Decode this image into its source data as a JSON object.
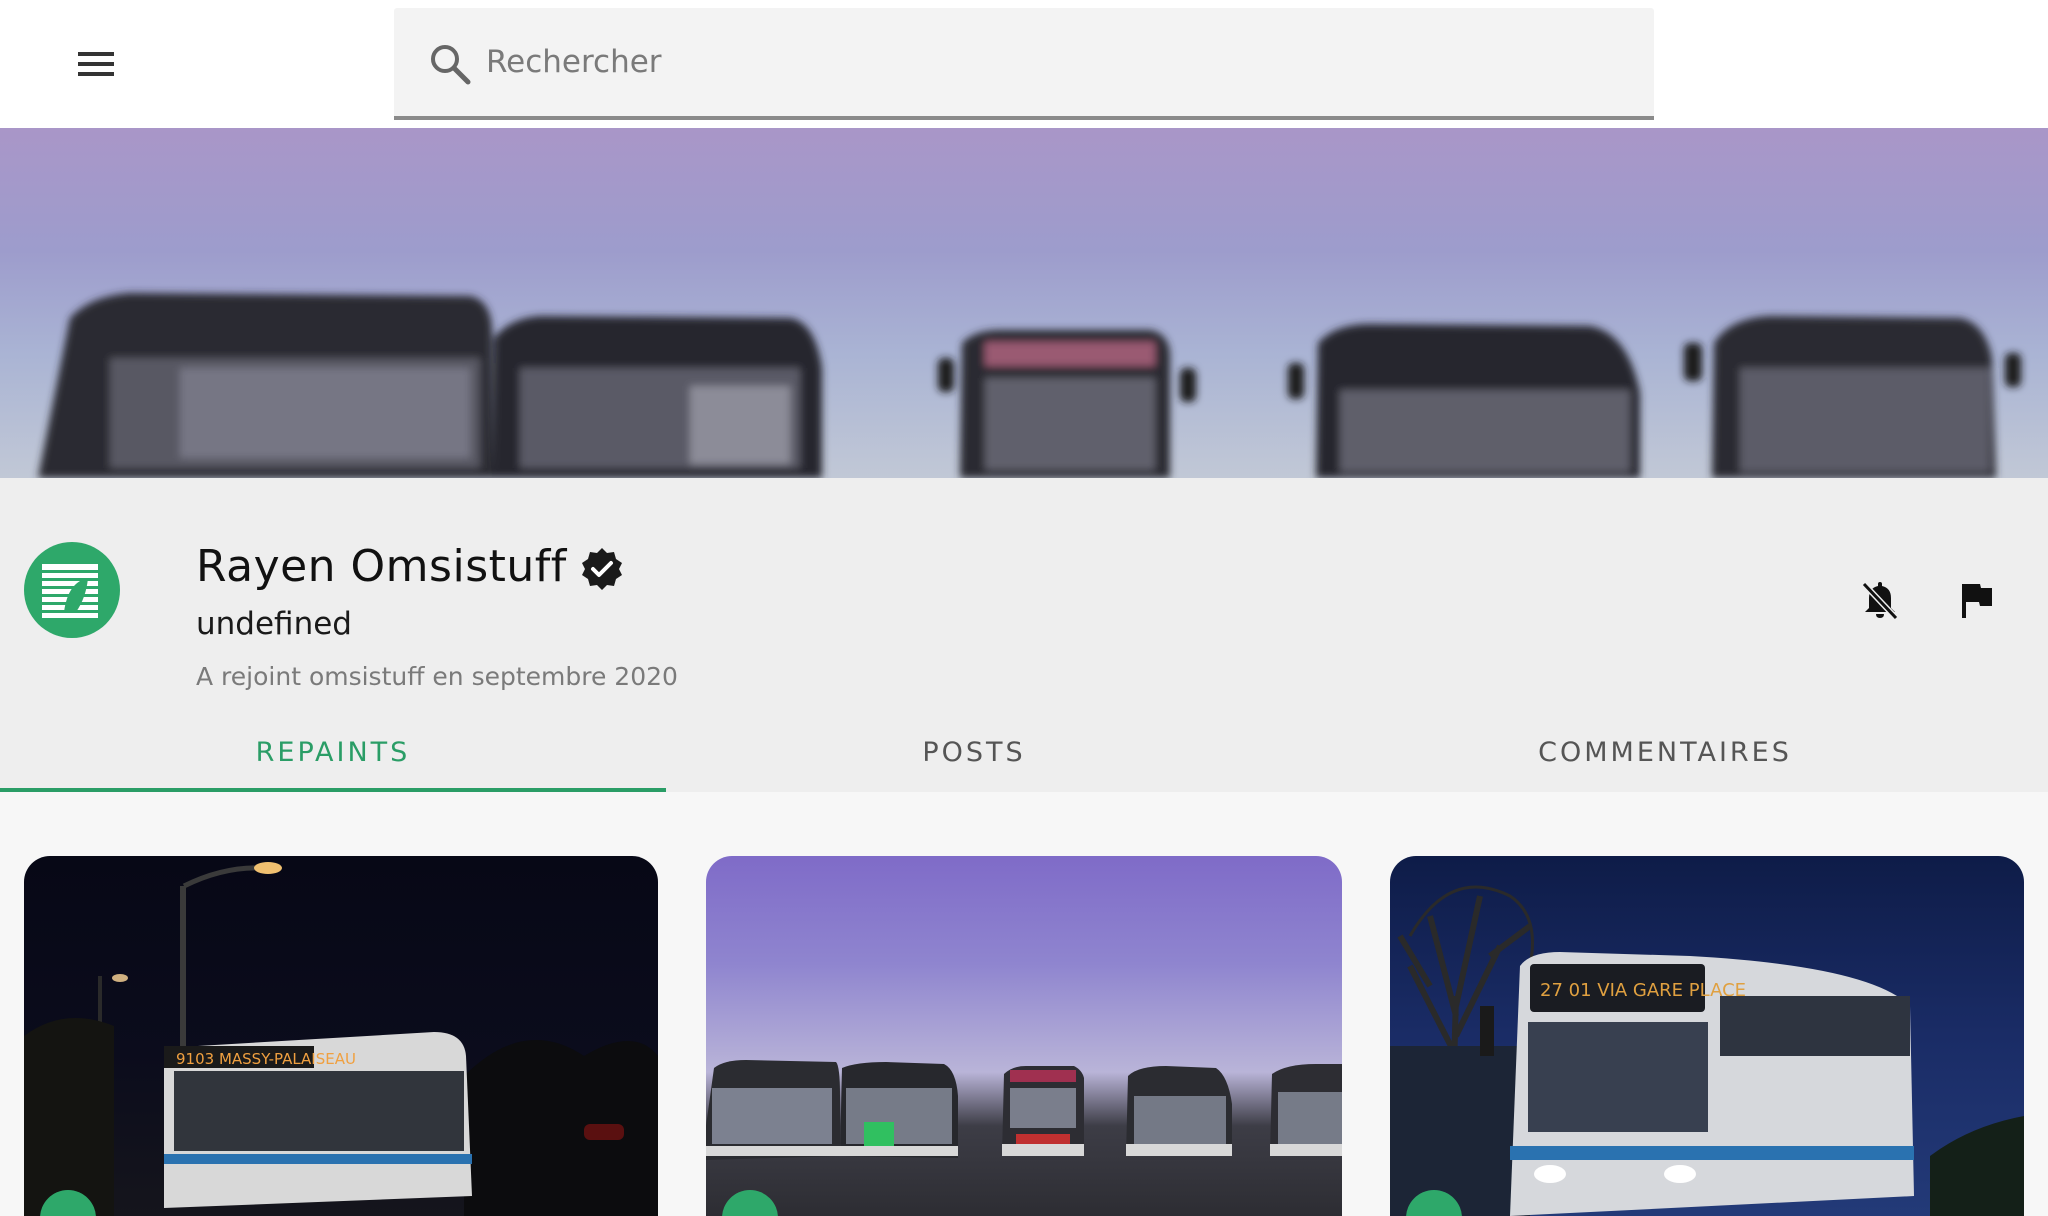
{
  "header": {
    "menu_icon": "menu-icon",
    "search": {
      "icon": "search-icon",
      "placeholder": "Rechercher",
      "value": ""
    }
  },
  "profile": {
    "name": "Rayen Omsistuff",
    "verified_icon": "verified-badge-icon",
    "subtitle": "undefined",
    "joined": "A rejoint omsistuff en septembre 2020",
    "actions": {
      "notifications_icon": "bell-off-icon",
      "report_icon": "flag-icon"
    }
  },
  "tabs": [
    {
      "label": "REPAINTS",
      "active": true
    },
    {
      "label": "POSTS",
      "active": false
    },
    {
      "label": "COMMENTAIRES",
      "active": false
    }
  ],
  "cards": [
    {
      "sign_text": "9103 MASSY-PALAISEAU"
    },
    {
      "sign_text": ""
    },
    {
      "sign_text": "27 01 VIA GARE PLACE"
    }
  ],
  "colors": {
    "accent": "#2a9d66",
    "avatar": "#2ea86a",
    "background": "#f7f7f7",
    "profile_bg": "#eeeeee"
  }
}
